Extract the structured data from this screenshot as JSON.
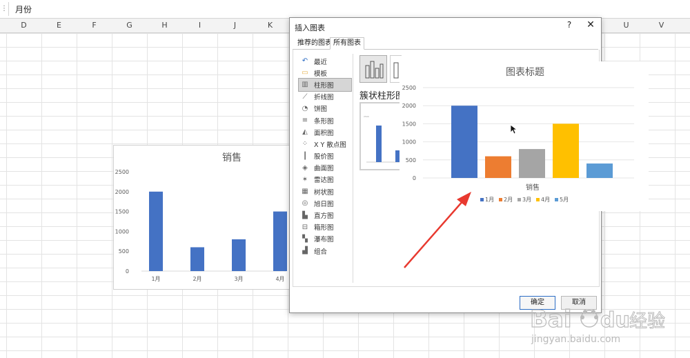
{
  "formula_bar": {
    "value": "月份"
  },
  "columns": [
    "D",
    "E",
    "F",
    "G",
    "H",
    "I",
    "J",
    "K",
    "U",
    "V"
  ],
  "background_chart": {
    "chart_data": {
      "type": "bar",
      "title": "销售",
      "categories": [
        "1月",
        "2月",
        "3月",
        "4月"
      ],
      "values": [
        2000,
        600,
        800,
        1500
      ],
      "ylim": [
        0,
        2500
      ],
      "yticks": [
        "2500",
        "2000",
        "1500",
        "1000",
        "500",
        "0"
      ],
      "color": "#4472c4"
    }
  },
  "dialog": {
    "title": "插入图表",
    "help": "?",
    "close": "✕",
    "tabs": [
      "推荐的图表",
      "所有图表"
    ],
    "chart_types": [
      {
        "label": "最近",
        "icon": "undo-icon"
      },
      {
        "label": "模板",
        "icon": "folder-icon"
      },
      {
        "label": "柱形图",
        "icon": "column-chart-icon"
      },
      {
        "label": "折线图",
        "icon": "line-chart-icon"
      },
      {
        "label": "饼图",
        "icon": "pie-chart-icon"
      },
      {
        "label": "条形图",
        "icon": "bar-chart-icon"
      },
      {
        "label": "面积图",
        "icon": "area-chart-icon"
      },
      {
        "label": "X Y 散点图",
        "icon": "scatter-chart-icon"
      },
      {
        "label": "股价图",
        "icon": "stock-chart-icon"
      },
      {
        "label": "曲面图",
        "icon": "surface-chart-icon"
      },
      {
        "label": "雷达图",
        "icon": "radar-chart-icon"
      },
      {
        "label": "树状图",
        "icon": "treemap-icon"
      },
      {
        "label": "旭日图",
        "icon": "sunburst-icon"
      },
      {
        "label": "直方图",
        "icon": "histogram-icon"
      },
      {
        "label": "箱形图",
        "icon": "boxplot-icon"
      },
      {
        "label": "瀑布图",
        "icon": "waterfall-icon"
      },
      {
        "label": "组合",
        "icon": "combo-chart-icon"
      }
    ],
    "selected_type": "柱形图",
    "subtype_title": "簇状柱形图",
    "ok": "确定",
    "cancel": "取消"
  },
  "preview_chart": {
    "chart_data": {
      "type": "bar",
      "title": "图表标题",
      "xlabel": "销售",
      "categories": [
        "1月",
        "2月",
        "3月",
        "4月",
        "5月"
      ],
      "series": [
        {
          "name": "1月",
          "value": 2000,
          "color": "#4472c4"
        },
        {
          "name": "2月",
          "value": 600,
          "color": "#ed7d31"
        },
        {
          "name": "3月",
          "value": 800,
          "color": "#a5a5a5"
        },
        {
          "name": "4月",
          "value": 1500,
          "color": "#ffc000"
        },
        {
          "name": "5月",
          "value": 400,
          "color": "#5b9bd5"
        }
      ],
      "ylim": [
        0,
        2500
      ],
      "yticks": [
        "2500",
        "2000",
        "1500",
        "1000",
        "500",
        "0"
      ],
      "legend": "bottom"
    }
  },
  "watermark": {
    "brand": "Bai",
    "brand2": "du",
    "suffix": "经验",
    "url": "jingyan.baidu.com"
  },
  "annotation": {
    "color": "#e8392f"
  }
}
